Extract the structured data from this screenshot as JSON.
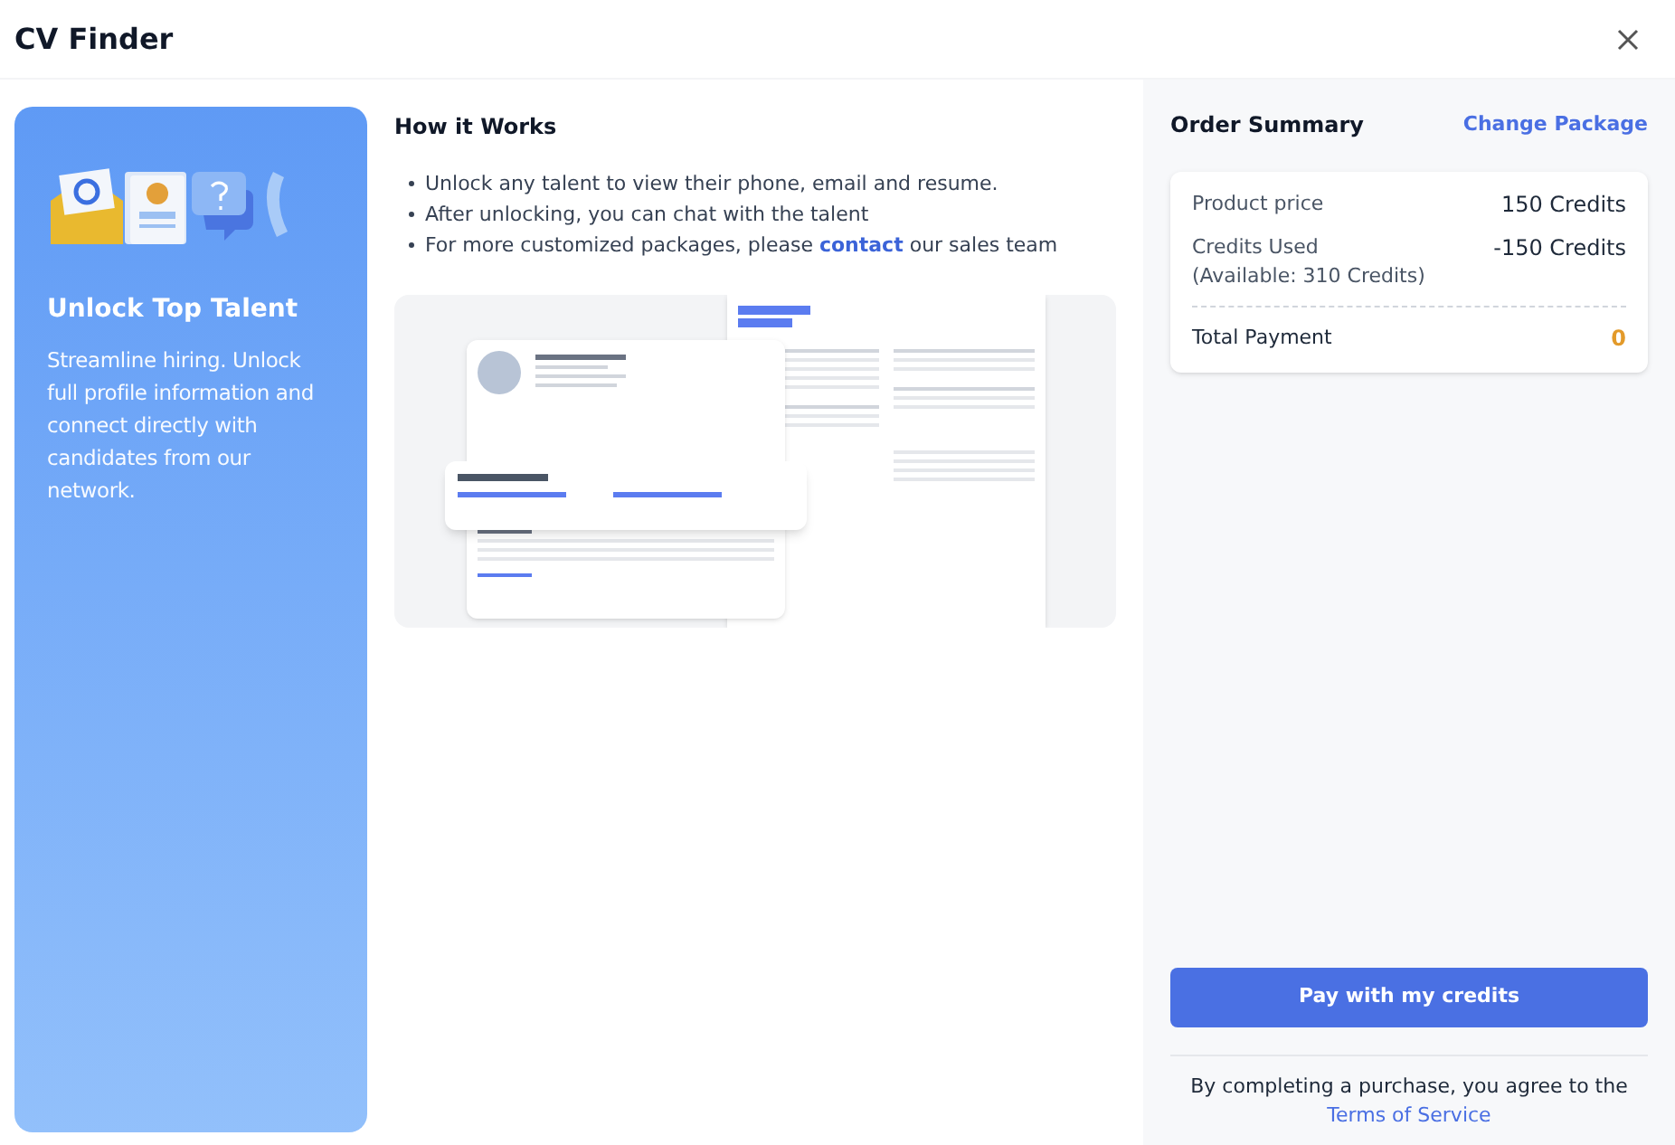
{
  "window": {
    "title": "CV Finder"
  },
  "promo": {
    "title": "Unlock Top Talent",
    "description": "Streamline hiring. Unlock full profile information and connect directly with candidates from our network."
  },
  "how_it_works": {
    "title": "How it Works",
    "bullets": [
      {
        "text": "Unlock any talent to view their phone, email and resume."
      },
      {
        "text": "After unlocking, you can chat with the talent"
      },
      {
        "text": "For more customized packages, please ",
        "link": "contact",
        "text_after": " our sales team"
      }
    ]
  },
  "order_summary": {
    "title": "Order Summary",
    "change_link": "Change Package",
    "rows": [
      {
        "label": "Product price",
        "value": "150 Credits"
      },
      {
        "label": "Credits Used",
        "sublabel": "(Available: 310 Credits)",
        "value": "-150 Credits"
      }
    ],
    "total": {
      "label": "Total Payment",
      "value": "0"
    },
    "pay_button": "Pay with my credits",
    "terms": {
      "text": "By completing a purchase, you agree to the ",
      "link": "Terms of Service"
    }
  }
}
